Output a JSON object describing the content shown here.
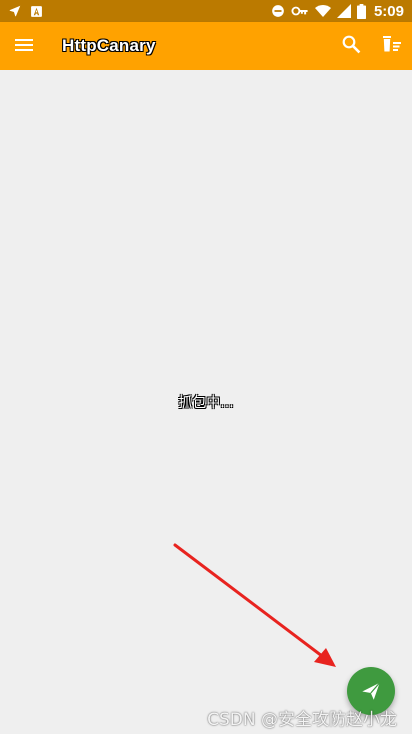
{
  "status_bar": {
    "time": "5:09",
    "icons": [
      "navigation-icon",
      "a-letter-icon",
      "do-not-disturb-icon",
      "vpn-key-icon",
      "wifi-icon",
      "cell-signal-icon",
      "battery-icon"
    ]
  },
  "app_bar": {
    "title": "HttpCanary",
    "icons": [
      "menu-icon",
      "search-icon",
      "delete-icon"
    ]
  },
  "content": {
    "status_text": "抓包中..."
  },
  "fab": {
    "icon": "send-icon"
  },
  "watermark": {
    "text": "CSDN @安全攻防赵小龙"
  },
  "colors": {
    "status_bar": "#bb7a00",
    "app_bar": "#ffa200",
    "background": "#efefef",
    "fab": "#3f9a3f",
    "annotation_arrow": "#e8231f"
  }
}
